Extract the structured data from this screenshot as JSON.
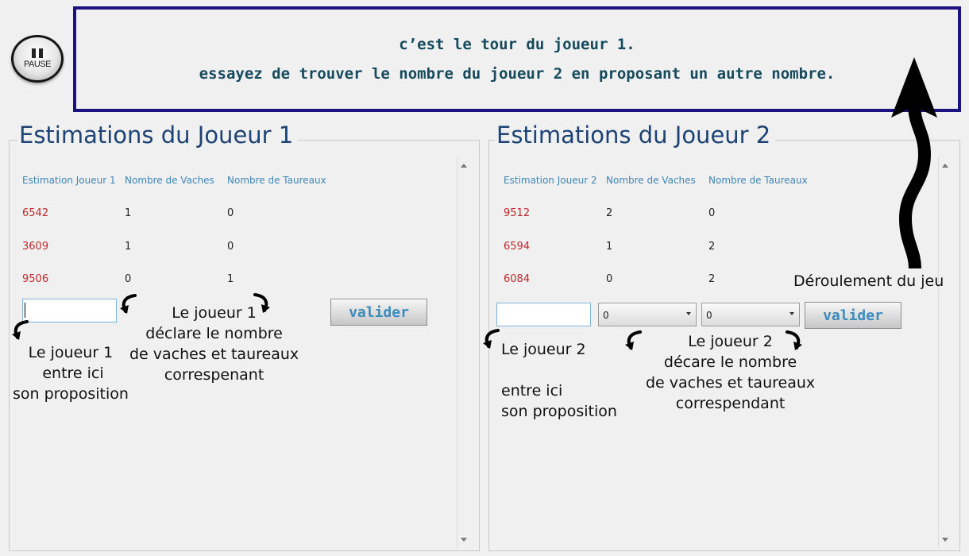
{
  "header": {
    "pause_label": "PAUSE",
    "message_line1": "c’est le tour du joueur 1.",
    "message_line2": "essayez de trouver le nombre du joueur 2 en proposant un autre nombre."
  },
  "player1": {
    "title": "Estimations du Joueur 1",
    "columns": [
      "Estimation Joueur 1",
      "Nombre de Vaches",
      "Nombre de Taureaux"
    ],
    "rows": [
      {
        "guess": "6542",
        "cows": "1",
        "bulls": "0"
      },
      {
        "guess": "3609",
        "cows": "1",
        "bulls": "0"
      },
      {
        "guess": "9506",
        "cows": "0",
        "bulls": "1"
      }
    ],
    "guess_value": "",
    "validate_label": "valider"
  },
  "player2": {
    "title": "Estimations du Joueur 2",
    "columns": [
      "Estimation Joueur 2",
      "Nombre de Vaches",
      "Nombre de Taureaux"
    ],
    "rows": [
      {
        "guess": "9512",
        "cows": "2",
        "bulls": "0"
      },
      {
        "guess": "6594",
        "cows": "1",
        "bulls": "2"
      },
      {
        "guess": "6084",
        "cows": "0",
        "bulls": "2"
      }
    ],
    "guess_value": "",
    "cows_select": "0",
    "bulls_select": "0",
    "validate_label": "valider"
  },
  "annotations": {
    "p1_input_note": "Le joueur 1\n entre ici\nson proposition",
    "p1_declare_note": "Le joueur 1\ndéclare le nombre\nde vaches et taureaux\ncorrespenant",
    "p2_input_note": "Le joueur 2\n\nentre ici\nson proposition",
    "p2_declare_note": "Le joueur 2\ndécare le nombre\nde vaches et taureaux\ncorrespendant",
    "flow_note": "Déroulement du jeu"
  },
  "colors": {
    "message_border": "#1b147f",
    "title": "#1c4373",
    "header_text": "#3d86b8",
    "guess_text": "#c0282c"
  }
}
